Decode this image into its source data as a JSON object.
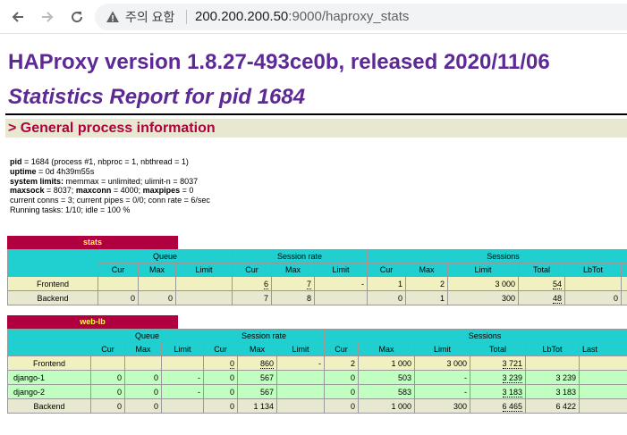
{
  "browser": {
    "security_label": "주의 요함",
    "url_host": "200.200.200.50",
    "url_rest": ":9000/haproxy_stats"
  },
  "page": {
    "title": "HAProxy version 1.8.27-493ce0b, released 2020/11/06",
    "subtitle": "Statistics Report for pid 1684",
    "section": "> General process information"
  },
  "info": {
    "pid_key": "pid",
    "pid_val": " = 1684 (process #1, nbproc = 1, nbthread = 1)",
    "uptime_key": "uptime",
    "uptime_val": " = 0d 4h39m55s",
    "limits_key": "system limits:",
    "limits_val": " memmax = unlimited; ulimit-n = 8037",
    "maxsock_key": "maxsock",
    "maxsock_val": " = 8037; ",
    "maxconn_key": "maxconn",
    "maxconn_val": " = 4000; ",
    "maxpipes_key": "maxpipes",
    "maxpipes_val": " = 0",
    "line5": "current conns = 3; current pipes = 0/0; conn rate = 6/sec",
    "line6": "Running tasks: 1/10; idle = 100 %"
  },
  "headers": {
    "queue": "Queue",
    "session_rate": "Session rate",
    "sessions": "Sessions",
    "cur": "Cur",
    "max": "Max",
    "limit": "Limit",
    "total": "Total",
    "lbtot": "LbTot",
    "last": "Last"
  },
  "stats": {
    "name": "stats",
    "frontend": {
      "label": "Frontend",
      "q_cur": "",
      "q_max": "",
      "q_lim": "",
      "r_cur": "6",
      "r_max": "7",
      "r_lim": "-",
      "s_cur": "1",
      "s_max": "2",
      "s_lim": "3 000",
      "s_tot": "54",
      "s_lbt": ""
    },
    "backend": {
      "label": "Backend",
      "q_cur": "0",
      "q_max": "0",
      "q_lim": "",
      "r_cur": "7",
      "r_max": "8",
      "r_lim": "",
      "s_cur": "0",
      "s_max": "1",
      "s_lim": "300",
      "s_tot": "48",
      "s_lbt": "0"
    }
  },
  "weblb": {
    "name": "web-lb",
    "frontend": {
      "label": "Frontend",
      "q_cur": "",
      "q_max": "",
      "q_lim": "",
      "r_cur": "0",
      "r_max": "860",
      "r_lim": "-",
      "s_cur": "2",
      "s_max": "1 000",
      "s_lim": "3 000",
      "s_tot": "3 721",
      "s_lbt": "",
      "s_last": ""
    },
    "servers": [
      {
        "label": "django-1",
        "q_cur": "0",
        "q_max": "0",
        "q_lim": "-",
        "r_cur": "0",
        "r_max": "567",
        "r_lim": "",
        "s_cur": "0",
        "s_max": "503",
        "s_lim": "-",
        "s_tot": "3 239",
        "s_lbt": "3 239",
        "s_last": ""
      },
      {
        "label": "django-2",
        "q_cur": "0",
        "q_max": "0",
        "q_lim": "-",
        "r_cur": "0",
        "r_max": "567",
        "r_lim": "",
        "s_cur": "0",
        "s_max": "583",
        "s_lim": "-",
        "s_tot": "3 183",
        "s_lbt": "3 183",
        "s_last": ""
      }
    ],
    "backend": {
      "label": "Backend",
      "q_cur": "0",
      "q_max": "0",
      "q_lim": "",
      "r_cur": "0",
      "r_max": "1 134",
      "r_lim": "",
      "s_cur": "0",
      "s_max": "1 000",
      "s_lim": "300",
      "s_tot": "6 465",
      "s_lbt": "6 422",
      "s_last": ""
    }
  }
}
